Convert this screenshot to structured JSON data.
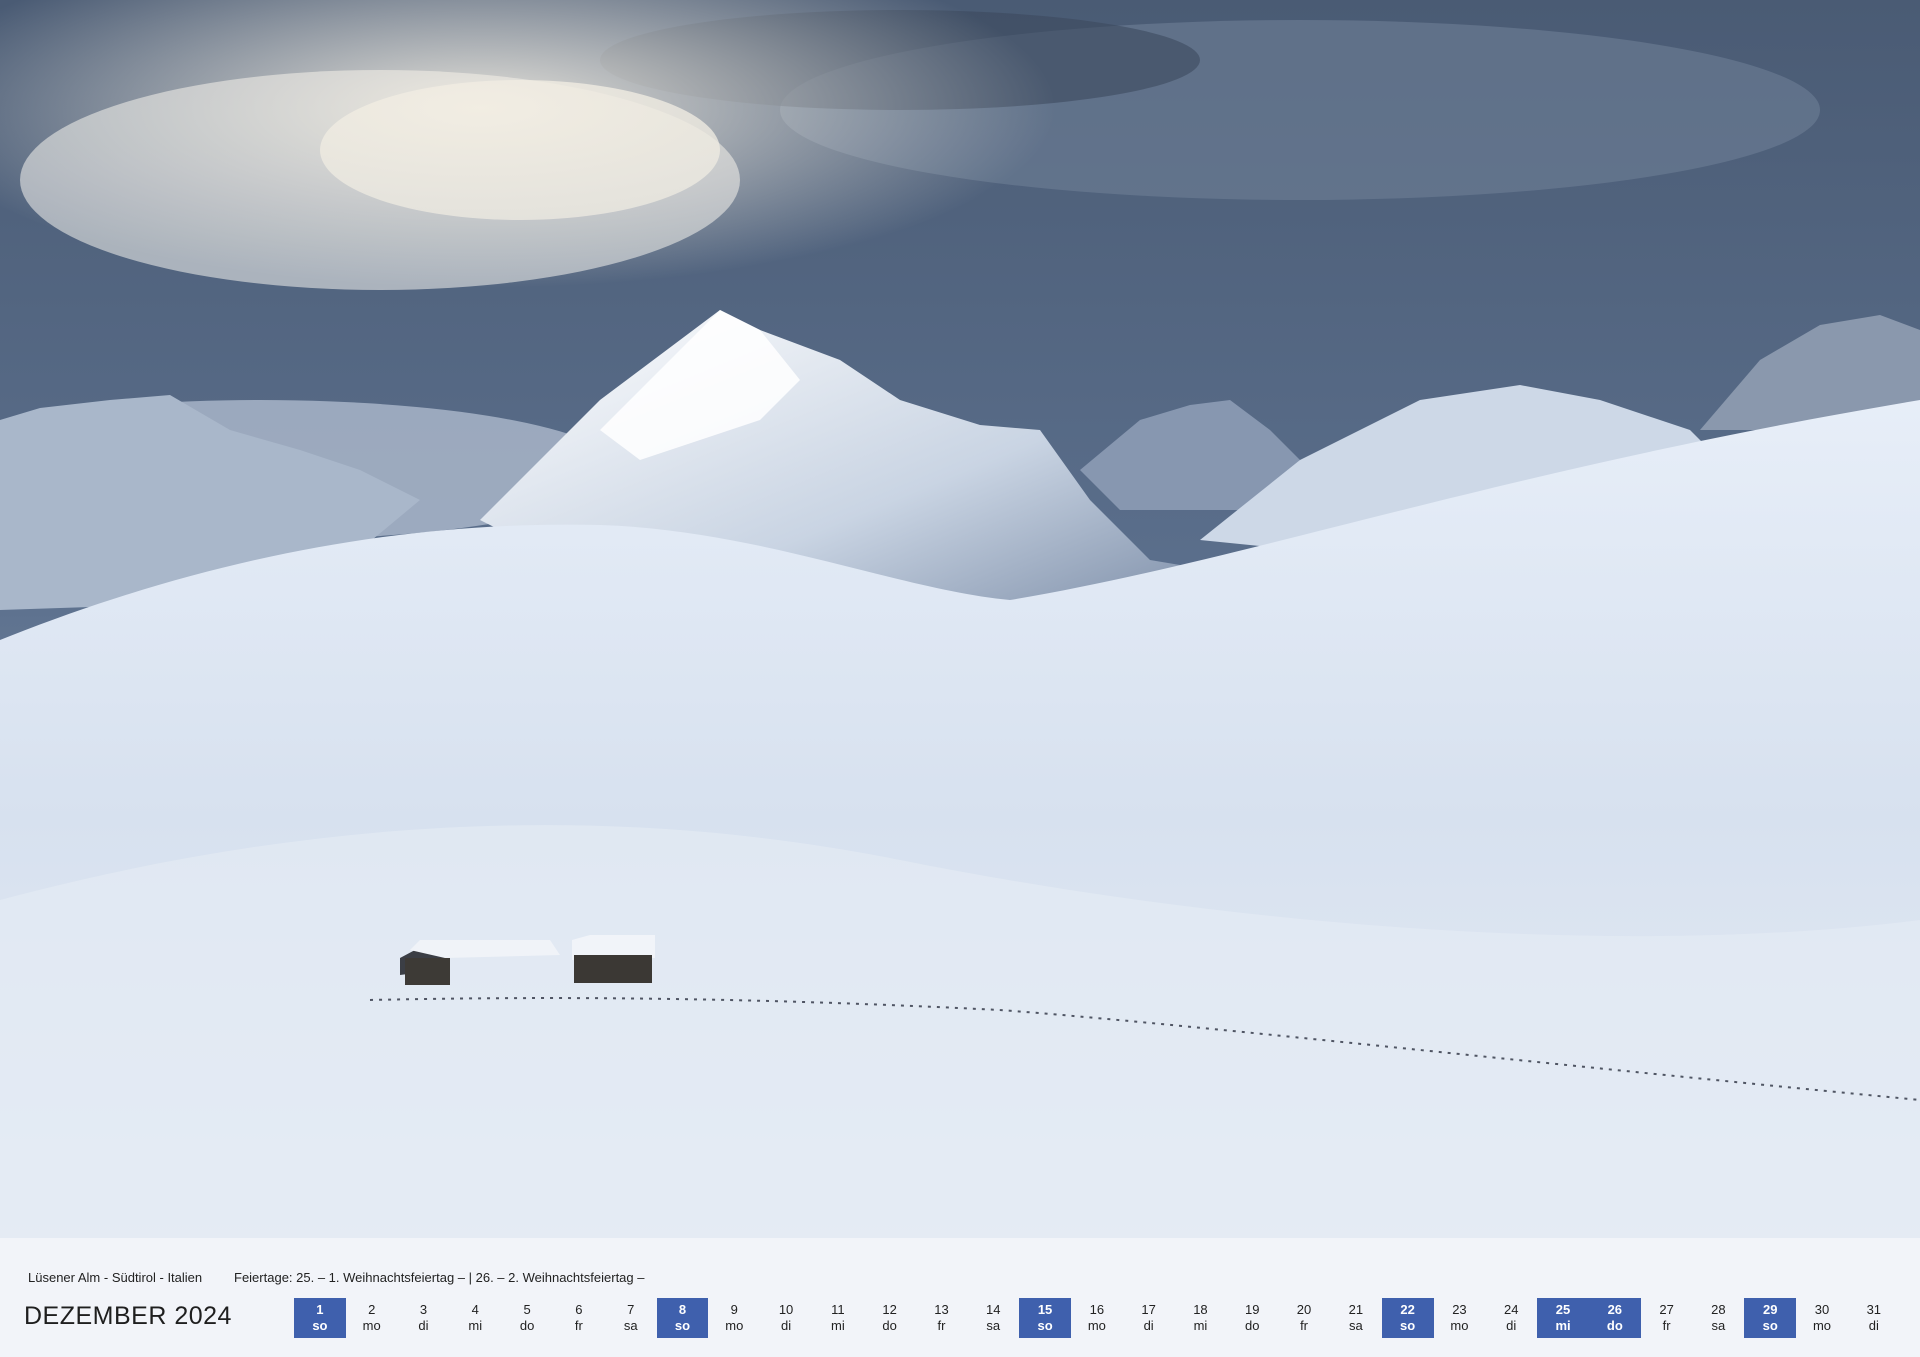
{
  "caption": {
    "location": "Lüsener Alm - Südtirol - Italien",
    "holidays": "Feiertage: 25. – 1. Weihnachtsfeiertag – | 26. – 2. Weihnachtsfeiertag –"
  },
  "month_title": "DEZEMBER 2024",
  "days": [
    {
      "num": "1",
      "wd": "so",
      "type": "sunday"
    },
    {
      "num": "2",
      "wd": "mo",
      "type": "normal"
    },
    {
      "num": "3",
      "wd": "di",
      "type": "normal"
    },
    {
      "num": "4",
      "wd": "mi",
      "type": "normal"
    },
    {
      "num": "5",
      "wd": "do",
      "type": "normal"
    },
    {
      "num": "6",
      "wd": "fr",
      "type": "normal"
    },
    {
      "num": "7",
      "wd": "sa",
      "type": "normal"
    },
    {
      "num": "8",
      "wd": "so",
      "type": "sunday"
    },
    {
      "num": "9",
      "wd": "mo",
      "type": "normal"
    },
    {
      "num": "10",
      "wd": "di",
      "type": "normal"
    },
    {
      "num": "11",
      "wd": "mi",
      "type": "normal"
    },
    {
      "num": "12",
      "wd": "do",
      "type": "normal"
    },
    {
      "num": "13",
      "wd": "fr",
      "type": "normal"
    },
    {
      "num": "14",
      "wd": "sa",
      "type": "normal"
    },
    {
      "num": "15",
      "wd": "so",
      "type": "sunday"
    },
    {
      "num": "16",
      "wd": "mo",
      "type": "normal"
    },
    {
      "num": "17",
      "wd": "di",
      "type": "normal"
    },
    {
      "num": "18",
      "wd": "mi",
      "type": "normal"
    },
    {
      "num": "19",
      "wd": "do",
      "type": "normal"
    },
    {
      "num": "20",
      "wd": "fr",
      "type": "normal"
    },
    {
      "num": "21",
      "wd": "sa",
      "type": "normal"
    },
    {
      "num": "22",
      "wd": "so",
      "type": "sunday"
    },
    {
      "num": "23",
      "wd": "mo",
      "type": "normal"
    },
    {
      "num": "24",
      "wd": "di",
      "type": "normal"
    },
    {
      "num": "25",
      "wd": "mi",
      "type": "holiday"
    },
    {
      "num": "26",
      "wd": "do",
      "type": "holiday"
    },
    {
      "num": "27",
      "wd": "fr",
      "type": "normal"
    },
    {
      "num": "28",
      "wd": "sa",
      "type": "normal"
    },
    {
      "num": "29",
      "wd": "so",
      "type": "sunday"
    },
    {
      "num": "30",
      "wd": "mo",
      "type": "normal"
    },
    {
      "num": "31",
      "wd": "di",
      "type": "normal"
    }
  ],
  "colors": {
    "highlight": "#3f60ad",
    "strip_background": "#f2f4f9",
    "text": "#222222"
  }
}
